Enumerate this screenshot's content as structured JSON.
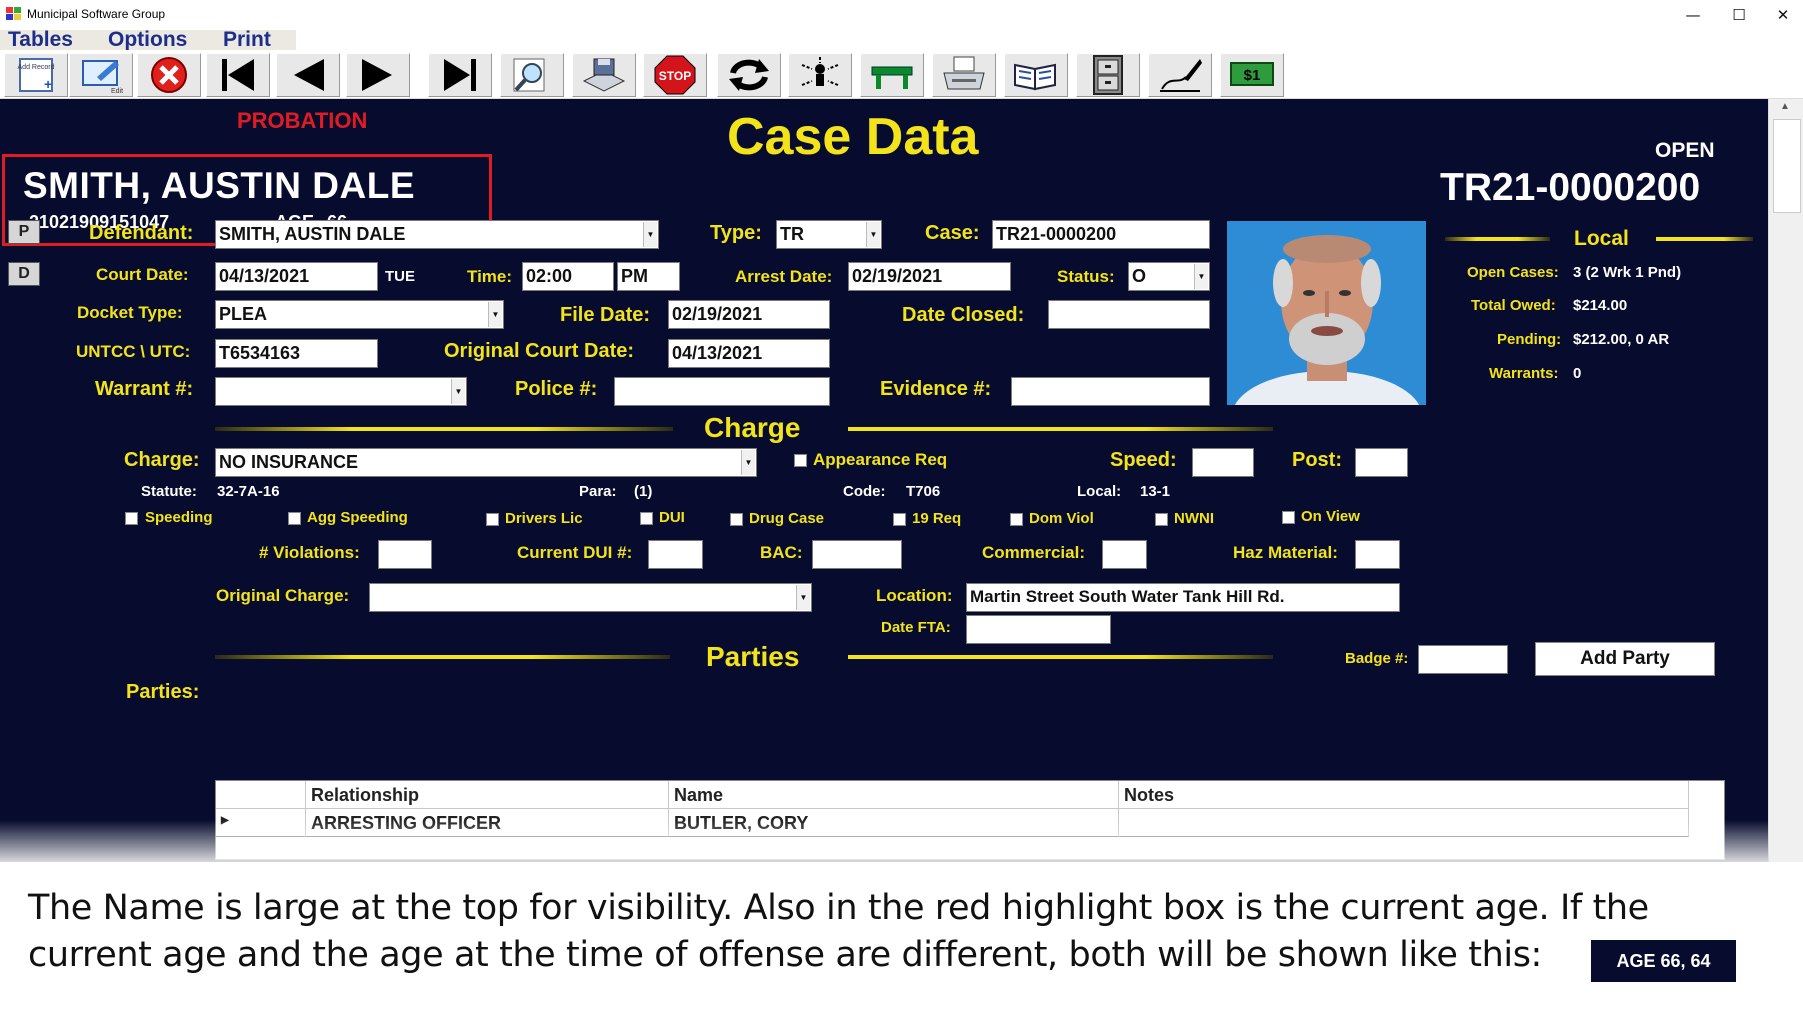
{
  "window": {
    "title": "Municipal Software Group",
    "minimize": "—",
    "maximize": "☐",
    "close": "✕"
  },
  "menu": [
    "Tables",
    "Options",
    "Print"
  ],
  "toolbar": [
    {
      "name": "add-record-icon",
      "label": "Add Record"
    },
    {
      "name": "edit-icon",
      "label": "Edit"
    },
    {
      "name": "delete-icon"
    },
    {
      "name": "first-record-icon"
    },
    {
      "name": "previous-record-icon"
    },
    {
      "name": "next-record-icon"
    },
    {
      "name": "last-record-icon"
    },
    {
      "name": "search-icon"
    },
    {
      "name": "save-icon"
    },
    {
      "name": "stop-icon",
      "label": "STOP"
    },
    {
      "name": "refresh-icon"
    },
    {
      "name": "network-icon"
    },
    {
      "name": "table-icon"
    },
    {
      "name": "printer-icon"
    },
    {
      "name": "book-icon"
    },
    {
      "name": "file-cabinet-icon"
    },
    {
      "name": "signature-icon"
    },
    {
      "name": "money-icon",
      "label": "$1"
    }
  ],
  "header": {
    "probation": "PROBATION",
    "title": "Case Data",
    "defendant_name": "SMITH, AUSTIN DALE",
    "defendant_id": "21021909151047",
    "age_label": "AGE",
    "age": "66",
    "case_status": "OPEN",
    "case_number": "TR21-0000200"
  },
  "side_buttons": [
    "P",
    "D"
  ],
  "form": {
    "defendant_label": "Defendant:",
    "defendant": "SMITH, AUSTIN DALE",
    "type_label": "Type:",
    "type": "TR",
    "case_label": "Case:",
    "case": "TR21-0000200",
    "court_date_label": "Court Date:",
    "court_date": "04/13/2021",
    "court_day": "TUE",
    "time_label": "Time:",
    "time": "02:00",
    "ampm": "PM",
    "arrest_date_label": "Arrest Date:",
    "arrest_date": "02/19/2021",
    "status_label": "Status:",
    "status": "O",
    "docket_type_label": "Docket Type:",
    "docket_type": "PLEA",
    "file_date_label": "File Date:",
    "file_date": "02/19/2021",
    "date_closed_label": "Date Closed:",
    "date_closed": "",
    "untcc_label": "UNTCC \\ UTC:",
    "untcc": "T6534163",
    "orig_court_date_label": "Original Court Date:",
    "orig_court_date": "04/13/2021",
    "warrant_label": "Warrant #:",
    "warrant": "",
    "police_label": "Police #:",
    "police": "",
    "evidence_label": "Evidence #:",
    "evidence": ""
  },
  "local": {
    "heading": "Local",
    "open_cases_label": "Open Cases:",
    "open_cases": "3 (2 Wrk  1 Pnd)",
    "total_owed_label": "Total Owed:",
    "total_owed": "$214.00",
    "pending_label": "Pending:",
    "pending": "$212.00,  0 AR",
    "warrants_label": "Warrants:",
    "warrants": "0"
  },
  "charge": {
    "heading": "Charge",
    "charge_label": "Charge:",
    "charge": "NO INSURANCE",
    "appearance_req": "Appearance Req",
    "speed_label": "Speed:",
    "speed": "",
    "post_label": "Post:",
    "post": "",
    "statute_label": "Statute:",
    "statute": "32-7A-16",
    "para_label": "Para:",
    "para": "(1)",
    "code_label": "Code:",
    "code": "T706",
    "local_label": "Local:",
    "local": "13-1",
    "flags": [
      "Speeding",
      "Agg Speeding",
      "Drivers Lic",
      "DUI",
      "Drug Case",
      "19 Req",
      "Dom Viol",
      "NWNI",
      "On View"
    ],
    "violations_label": "# Violations:",
    "violations": "",
    "current_dui_label": "Current DUI #:",
    "current_dui": "",
    "bac_label": "BAC:",
    "bac": "",
    "commercial_label": "Commercial:",
    "commercial": "",
    "haz_material_label": "Haz Material:",
    "haz_material": "",
    "original_charge_label": "Original Charge:",
    "original_charge": "",
    "location_label": "Location:",
    "location": "Martin Street South   Water Tank Hill Rd.",
    "date_fta_label": "Date FTA:",
    "date_fta": ""
  },
  "parties": {
    "heading": "Parties",
    "badge_label": "Badge #:",
    "badge": "",
    "add_party": "Add Party",
    "parties_label": "Parties:",
    "columns": [
      "Relationship",
      "Name",
      "Notes"
    ],
    "rows": [
      [
        "ARRESTING OFFICER",
        "BUTLER, CORY",
        ""
      ]
    ]
  },
  "caption": {
    "line1": "The Name is large at the top for visibility.  Also in the red highlight box is the current age.   If the",
    "line2": "current age and the age at the time of offense are different, both will be shown like this:",
    "age_sample": "AGE  66, 64"
  },
  "colors": {
    "panel": "#070b2d",
    "label": "#f2e31a",
    "highlight": "#e01b24",
    "probation": "#e01b24"
  }
}
